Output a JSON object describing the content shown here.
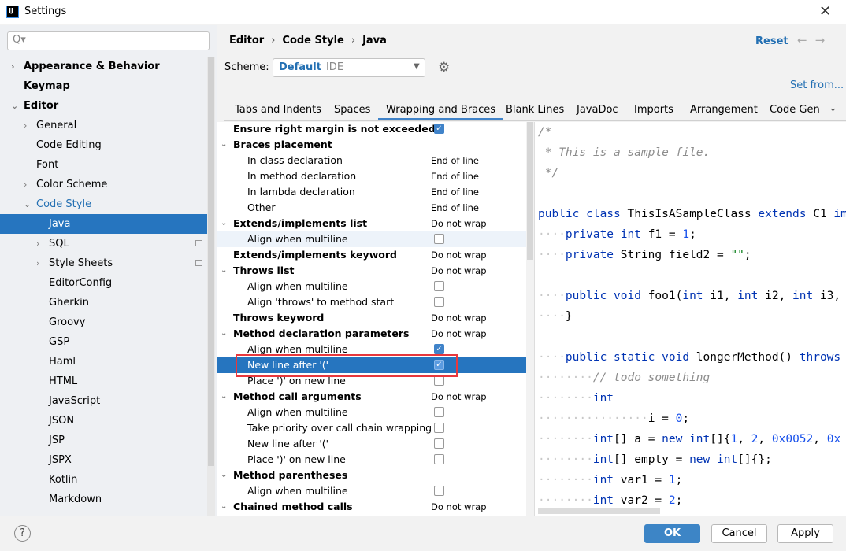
{
  "window": {
    "title": "Settings",
    "app_icon": "IJ"
  },
  "sidebar": {
    "search_placeholder": "Q▾",
    "items": [
      {
        "label": "Appearance & Behavior",
        "level": 0,
        "bold": true,
        "arrow": "›"
      },
      {
        "label": "Keymap",
        "level": 0,
        "bold": true,
        "arrow": ""
      },
      {
        "label": "Editor",
        "level": 0,
        "bold": true,
        "arrow": "⌄"
      },
      {
        "label": "General",
        "level": 1,
        "arrow": "›"
      },
      {
        "label": "Code Editing",
        "level": 1,
        "arrow": ""
      },
      {
        "label": "Font",
        "level": 1,
        "arrow": ""
      },
      {
        "label": "Color Scheme",
        "level": 1,
        "arrow": "›"
      },
      {
        "label": "Code Style",
        "level": 1,
        "arrow": "⌄",
        "blue": true
      },
      {
        "label": "Java",
        "level": 2,
        "arrow": "",
        "selected": true
      },
      {
        "label": "SQL",
        "level": 2,
        "arrow": "›",
        "badge": true
      },
      {
        "label": "Style Sheets",
        "level": 2,
        "arrow": "›",
        "badge": true
      },
      {
        "label": "EditorConfig",
        "level": 2,
        "arrow": ""
      },
      {
        "label": "Gherkin",
        "level": 2,
        "arrow": ""
      },
      {
        "label": "Groovy",
        "level": 2,
        "arrow": ""
      },
      {
        "label": "GSP",
        "level": 2,
        "arrow": ""
      },
      {
        "label": "Haml",
        "level": 2,
        "arrow": ""
      },
      {
        "label": "HTML",
        "level": 2,
        "arrow": ""
      },
      {
        "label": "JavaScript",
        "level": 2,
        "arrow": ""
      },
      {
        "label": "JSON",
        "level": 2,
        "arrow": ""
      },
      {
        "label": "JSP",
        "level": 2,
        "arrow": ""
      },
      {
        "label": "JSPX",
        "level": 2,
        "arrow": ""
      },
      {
        "label": "Kotlin",
        "level": 2,
        "arrow": ""
      },
      {
        "label": "Markdown",
        "level": 2,
        "arrow": ""
      }
    ]
  },
  "header": {
    "breadcrumb": [
      "Editor",
      "Code Style",
      "Java"
    ],
    "breadcrumb_sep": "›",
    "reset": "Reset",
    "back": "←",
    "forward": "→"
  },
  "scheme": {
    "label": "Scheme:",
    "name": "Default",
    "sub": "IDE",
    "set_from": "Set from..."
  },
  "tabs": {
    "items": [
      "Tabs and Indents",
      "Spaces",
      "Wrapping and Braces",
      "Blank Lines",
      "JavaDoc",
      "Imports",
      "Arrangement",
      "Code Gen"
    ],
    "active": 2,
    "more": "⌄"
  },
  "options": [
    {
      "label": "Ensure right margin is not exceeded",
      "bold": true,
      "check": true
    },
    {
      "label": "Braces placement",
      "bold": true,
      "arrow": true
    },
    {
      "label": "In class declaration",
      "indent": true,
      "value": "End of line"
    },
    {
      "label": "In method declaration",
      "indent": true,
      "value": "End of line"
    },
    {
      "label": "In lambda declaration",
      "indent": true,
      "value": "End of line"
    },
    {
      "label": "Other",
      "indent": true,
      "value": "End of line"
    },
    {
      "label": "Extends/implements list",
      "bold": true,
      "arrow": true,
      "value": "Do not wrap"
    },
    {
      "label": "Align when multiline",
      "indent": true,
      "check": false,
      "hover": true
    },
    {
      "label": "Extends/implements keyword",
      "bold": true,
      "value": "Do not wrap"
    },
    {
      "label": "Throws list",
      "bold": true,
      "arrow": true,
      "value": "Do not wrap"
    },
    {
      "label": "Align when multiline",
      "indent": true,
      "check": false
    },
    {
      "label": "Align 'throws' to method start",
      "indent": true,
      "check": false
    },
    {
      "label": "Throws keyword",
      "bold": true,
      "value": "Do not wrap"
    },
    {
      "label": "Method declaration parameters",
      "bold": true,
      "arrow": true,
      "value": "Do not wrap"
    },
    {
      "label": "Align when multiline",
      "indent": true,
      "check": true
    },
    {
      "label": "New line after '('",
      "indent": true,
      "check": true,
      "selected": true
    },
    {
      "label": "Place ')' on new line",
      "indent": true,
      "check": false
    },
    {
      "label": "Method call arguments",
      "bold": true,
      "arrow": true,
      "value": "Do not wrap"
    },
    {
      "label": "Align when multiline",
      "indent": true,
      "check": false
    },
    {
      "label": "Take priority over call chain wrapping",
      "indent": true,
      "check": false
    },
    {
      "label": "New line after '('",
      "indent": true,
      "check": false
    },
    {
      "label": "Place ')' on new line",
      "indent": true,
      "check": false
    },
    {
      "label": "Method parentheses",
      "bold": true,
      "arrow": true
    },
    {
      "label": "Align when multiline",
      "indent": true,
      "check": false
    },
    {
      "label": "Chained method calls",
      "bold": true,
      "arrow": true,
      "value": "Do not wrap"
    }
  ],
  "code_preview": [
    [
      [
        "cm",
        "/*"
      ]
    ],
    [
      [
        "cm",
        " * This is a sample file."
      ]
    ],
    [
      [
        "cm",
        " */"
      ]
    ],
    [],
    [
      [
        "kw",
        "public class "
      ],
      [
        "",
        "ThisIsASampleClass "
      ],
      [
        "kw",
        "extends "
      ],
      [
        "",
        "C1 "
      ],
      [
        "kw",
        "implements"
      ]
    ],
    [
      [
        "",
        "    "
      ],
      [
        "kw",
        "private int "
      ],
      [
        "",
        "f1 = "
      ],
      [
        "num",
        "1"
      ],
      [
        "",
        ";"
      ]
    ],
    [
      [
        "",
        "    "
      ],
      [
        "kw",
        "private "
      ],
      [
        "",
        "String field2 = "
      ],
      [
        "str",
        "\"\""
      ],
      [
        "",
        ";"
      ]
    ],
    [],
    [
      [
        "",
        "    "
      ],
      [
        "kw",
        "public void "
      ],
      [
        "",
        "foo1("
      ],
      [
        "kw",
        "int "
      ],
      [
        "",
        "i1, "
      ],
      [
        "kw",
        "int "
      ],
      [
        "",
        "i2, "
      ],
      [
        "kw",
        "int "
      ],
      [
        "",
        "i3,"
      ]
    ],
    [
      [
        "",
        "    }"
      ]
    ],
    [],
    [
      [
        "",
        "    "
      ],
      [
        "kw",
        "public static void "
      ],
      [
        "",
        "longerMethod() "
      ],
      [
        "kw",
        "throws"
      ]
    ],
    [
      [
        "",
        "        "
      ],
      [
        "cm",
        "// todo something"
      ]
    ],
    [
      [
        "",
        "        "
      ],
      [
        "kw",
        "int"
      ]
    ],
    [
      [
        "",
        "                i = "
      ],
      [
        "num",
        "0"
      ],
      [
        "",
        ";"
      ]
    ],
    [
      [
        "",
        "        "
      ],
      [
        "kw",
        "int"
      ],
      [
        "",
        "[] a = "
      ],
      [
        "kw",
        "new int"
      ],
      [
        "",
        "[]{"
      ],
      [
        "num",
        "1"
      ],
      [
        "",
        ", "
      ],
      [
        "num",
        "2"
      ],
      [
        "",
        ", "
      ],
      [
        "num",
        "0x0052"
      ],
      [
        "",
        ", "
      ],
      [
        "num",
        "0x"
      ]
    ],
    [
      [
        "",
        "        "
      ],
      [
        "kw",
        "int"
      ],
      [
        "",
        "[] empty = "
      ],
      [
        "kw",
        "new int"
      ],
      [
        "",
        "[]{};"
      ]
    ],
    [
      [
        "",
        "        "
      ],
      [
        "kw",
        "int "
      ],
      [
        "",
        "var1 = "
      ],
      [
        "num",
        "1"
      ],
      [
        "",
        ";"
      ]
    ],
    [
      [
        "",
        "        "
      ],
      [
        "kw",
        "int "
      ],
      [
        "",
        "var2 = "
      ],
      [
        "num",
        "2"
      ],
      [
        "",
        ";"
      ]
    ]
  ],
  "footer": {
    "help": "?",
    "ok": "OK",
    "cancel": "Cancel",
    "apply": "Apply"
  },
  "colors": {
    "accent": "#2675bf",
    "highlight_box": "#e8383d",
    "ok_button": "#3d85c6"
  }
}
